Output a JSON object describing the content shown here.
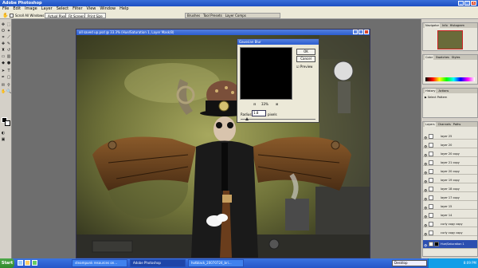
{
  "app": {
    "title": "Adobe Photoshop"
  },
  "menu": [
    "File",
    "Edit",
    "Image",
    "Layer",
    "Select",
    "Filter",
    "View",
    "Window",
    "Help"
  ],
  "options": {
    "check_label": "Scroll All Windows",
    "buttons": [
      "Actual Pixels",
      "Fit Screen",
      "Print Size"
    ]
  },
  "palette_well": [
    "Brushes",
    "Tool Presets",
    "Layer Comps"
  ],
  "document": {
    "title": "all saved up.psd @ 33.3% (Hue/Saturation 1, Layer Mask/8)"
  },
  "dialog": {
    "title": "Gaussian Blur",
    "ok": "OK",
    "cancel": "Cancel",
    "preview": "Preview",
    "zoom": "33%",
    "radius_label": "Radius:",
    "radius_value": "1.8",
    "radius_unit": "pixels"
  },
  "panels": {
    "navigator": {
      "tabs": [
        "Navigator",
        "Info",
        "Histogram"
      ]
    },
    "color": {
      "tabs": [
        "Color",
        "Swatches",
        "Styles"
      ]
    },
    "history": {
      "tabs": [
        "History",
        "Actions"
      ],
      "items": [
        "Select Pattern"
      ]
    },
    "layers": {
      "tabs": [
        "Layers",
        "Channels",
        "Paths"
      ],
      "rows": [
        {
          "name": "layer 25",
          "selected": false
        },
        {
          "name": "layer 20",
          "selected": false
        },
        {
          "name": "layer 20 copy",
          "selected": false
        },
        {
          "name": "layer 21 copy",
          "selected": false
        },
        {
          "name": "layer 20 copy",
          "selected": false
        },
        {
          "name": "layer 19 copy",
          "selected": false
        },
        {
          "name": "layer 18 copy",
          "selected": false
        },
        {
          "name": "layer 17 copy",
          "selected": false
        },
        {
          "name": "layer 15",
          "selected": false
        },
        {
          "name": "layer 14",
          "selected": false
        },
        {
          "name": "curly copy copy",
          "selected": false
        },
        {
          "name": "curly copy copy",
          "selected": false
        },
        {
          "name": "Hue/Saturation 1",
          "selected": true
        }
      ]
    }
  },
  "taskbar": {
    "start": "Start",
    "items": [
      {
        "label": "steampunk resources on...",
        "active": false
      },
      {
        "label": "Adobe Photoshop",
        "active": true
      },
      {
        "label": "hotblack_20070724_bri...",
        "active": false
      }
    ],
    "desktop": "Desktop",
    "clock": "8:09 PM"
  }
}
